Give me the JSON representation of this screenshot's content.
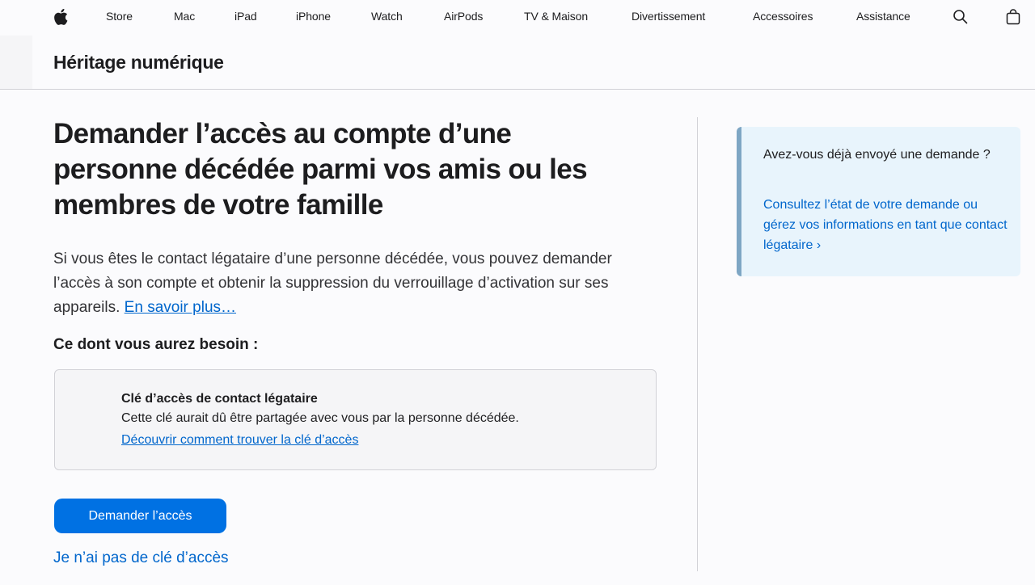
{
  "global_nav": {
    "items": [
      "Store",
      "Mac",
      "iPad",
      "iPhone",
      "Watch",
      "AirPods",
      "TV & Maison",
      "Divertissement",
      "Accessoires",
      "Assistance"
    ],
    "logo_icon": "apple-logo-icon",
    "search_icon": "search-icon",
    "bag_icon": "shopping-bag-icon"
  },
  "local_nav": {
    "title": "Héritage numérique"
  },
  "main": {
    "headline": "Demander l’accès au compte d’une personne décédée parmi vos amis ou les membres de votre famille",
    "intro_text": "Si vous êtes le contact légataire d’une personne décédée, vous pouvez demander l’accès à son compte et obtenir la suppression du verrouillage d’activation sur ses appareils. ",
    "intro_link": "En savoir plus…",
    "need_heading": "Ce dont vous aurez besoin :",
    "requirement": {
      "title": "Clé d’accès de contact légataire",
      "description": "Cette clé aurait dû être partagée avec vous par la personne décédée.",
      "link": "Découvrir comment trouver la clé d’accès"
    },
    "cta_label": "Demander l’accès",
    "no_key_link": "Je n’ai pas de clé d’accès"
  },
  "aside": {
    "question": "Avez-vous déjà envoyé une demande ?",
    "link": "Consultez l’état de votre demande ou gérez vos informations en tant que contact légataire ›"
  },
  "colors": {
    "accent": "#0071e3",
    "link": "#0066cc",
    "aside_bg": "#e8f4fc",
    "aside_border": "#7ea6c4"
  }
}
